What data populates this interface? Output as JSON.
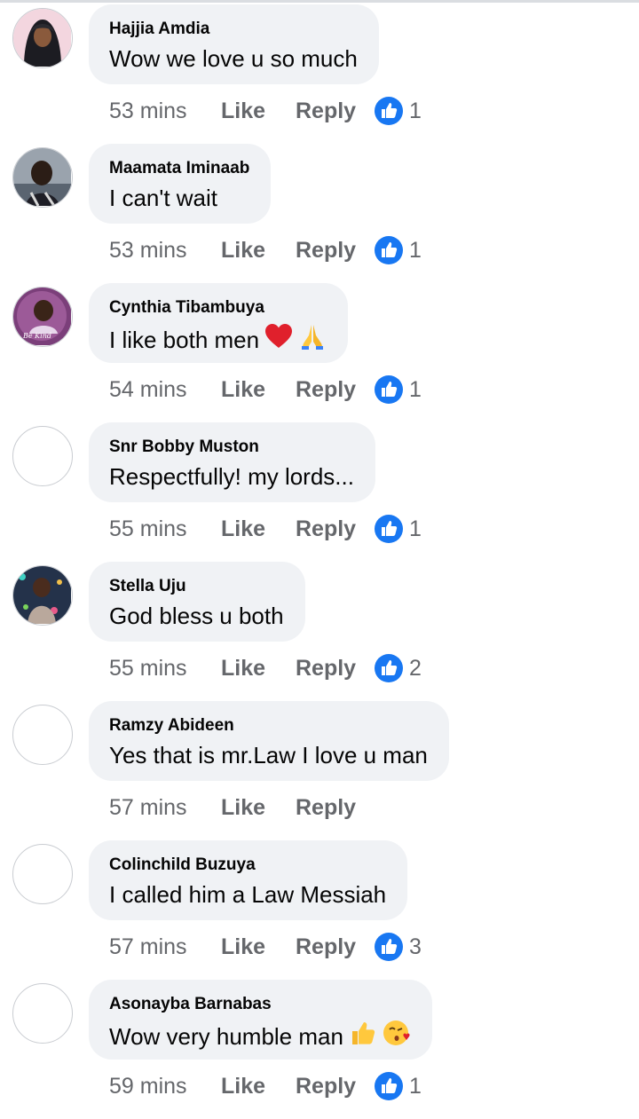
{
  "actions": {
    "like": "Like",
    "reply": "Reply"
  },
  "colors": {
    "bubble": "#f0f2f5",
    "like_blue": "#1877f2",
    "meta_gray": "#65676b"
  },
  "comments": [
    {
      "author": "Hajjia Amdia",
      "text": "Wow we love u so much",
      "time": "53 mins",
      "likes": "1",
      "avatar": "photo-avatar"
    },
    {
      "author": "Maamata Iminaab",
      "text": "I can't wait",
      "time": "53 mins",
      "likes": "1",
      "avatar": "photo-avatar"
    },
    {
      "author": "Cynthia Tibambuya",
      "text": "I like both men",
      "emojis": [
        "red-heart-icon",
        "folded-hands-icon"
      ],
      "time": "54 mins",
      "likes": "1",
      "avatar": "photo-avatar",
      "avatar_caption": "Be Kind"
    },
    {
      "author": "Snr Bobby Muston",
      "text": "Respectfully! my lords...",
      "time": "55 mins",
      "likes": "1",
      "avatar": "blank-avatar"
    },
    {
      "author": "Stella Uju",
      "text": "God bless u both",
      "time": "55 mins",
      "likes": "2",
      "avatar": "photo-avatar"
    },
    {
      "author": "Ramzy Abideen",
      "text": "Yes that is mr.Law I love u man",
      "time": "57 mins",
      "likes": "",
      "avatar": "blank-avatar"
    },
    {
      "author": "Colinchild Buzuya",
      "text": "I called him a Law Messiah",
      "time": "57 mins",
      "likes": "3",
      "avatar": "blank-avatar"
    },
    {
      "author": "Asonayba Barnabas",
      "text": "Wow very humble man",
      "emojis": [
        "thumbs-up-icon",
        "face-blowing-kiss-icon"
      ],
      "time": "59 mins",
      "likes": "1",
      "avatar": "blank-avatar"
    }
  ]
}
